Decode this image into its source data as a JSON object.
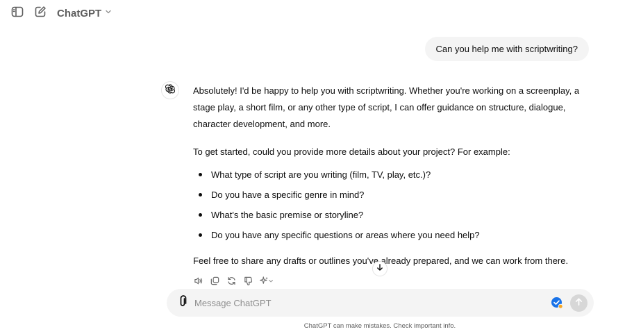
{
  "header": {
    "model_name": "ChatGPT"
  },
  "conversation": {
    "user_message": "Can you help me with scriptwriting?",
    "assistant": {
      "paragraph1": "Absolutely! I'd be happy to help you with scriptwriting. Whether you're working on a screenplay, a stage play, a short film, or any other type of script, I can offer guidance on structure, dialogue, character development, and more.",
      "paragraph2": "To get started, could you provide more details about your project? For example:",
      "bullets": [
        "What type of script are you writing (film, TV, play, etc.)?",
        "Do you have a specific genre in mind?",
        "What's the basic premise or storyline?",
        "Do you have any specific questions or areas where you need help?"
      ],
      "paragraph3": "Feel free to share any drafts or outlines you've already prepared, and we can work from there."
    }
  },
  "composer": {
    "placeholder": "Message ChatGPT"
  },
  "footer": {
    "disclaimer": "ChatGPT can make mistakes. Check important info."
  },
  "icons": {
    "sidebar_toggle": "sidebar-icon",
    "new_chat": "edit-icon",
    "model_chevron": "chevron-down-icon",
    "assistant_avatar": "openai-logo-icon",
    "read_aloud": "speaker-icon",
    "copy": "copy-icon",
    "regenerate": "refresh-icon",
    "dislike": "thumbs-down-icon",
    "change_model": "sparkle-icon",
    "scroll_down": "arrow-down-icon",
    "attach": "paperclip-icon",
    "grammar": "check-badge-icon",
    "send": "arrow-up-icon"
  },
  "colors": {
    "bubble_bg": "#f4f4f4",
    "text": "#0d0d0d",
    "muted": "#5d5d5d",
    "send_disabled": "#d7d7d7",
    "badge_blue": "#1a73e8"
  }
}
